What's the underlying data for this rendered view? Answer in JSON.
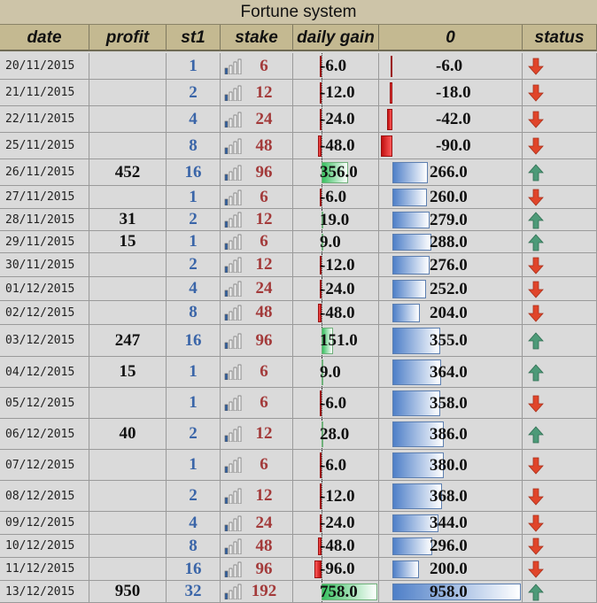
{
  "title": "Fortune system",
  "headers": [
    "date",
    "profit",
    "st1",
    "stake",
    "daily gain",
    "0",
    "status"
  ],
  "colors": {
    "up": "#4d9a78",
    "down": "#e0452a"
  },
  "rows": [
    {
      "date": "20/11/2015",
      "profit": "",
      "st1": "1",
      "stake": "6",
      "gain": "-6.0",
      "cum": "-6.0",
      "status": "down-arrow-icon"
    },
    {
      "date": "21/11/2015",
      "profit": "",
      "st1": "2",
      "stake": "12",
      "gain": "-12.0",
      "cum": "-18.0",
      "status": "down-arrow-icon"
    },
    {
      "date": "22/11/2015",
      "profit": "",
      "st1": "4",
      "stake": "24",
      "gain": "-24.0",
      "cum": "-42.0",
      "status": "down-arrow-icon"
    },
    {
      "date": "25/11/2015",
      "profit": "",
      "st1": "8",
      "stake": "48",
      "gain": "-48.0",
      "cum": "-90.0",
      "status": "down-arrow-icon"
    },
    {
      "date": "26/11/2015",
      "profit": "452",
      "st1": "16",
      "stake": "96",
      "gain": "356.0",
      "cum": "266.0",
      "status": "up-arrow-icon"
    },
    {
      "date": "27/11/2015",
      "profit": "",
      "st1": "1",
      "stake": "6",
      "gain": "-6.0",
      "cum": "260.0",
      "status": "down-arrow-icon"
    },
    {
      "date": "28/11/2015",
      "profit": "31",
      "st1": "2",
      "stake": "12",
      "gain": "19.0",
      "cum": "279.0",
      "status": "up-arrow-icon"
    },
    {
      "date": "29/11/2015",
      "profit": "15",
      "st1": "1",
      "stake": "6",
      "gain": "9.0",
      "cum": "288.0",
      "status": "up-arrow-icon"
    },
    {
      "date": "30/11/2015",
      "profit": "",
      "st1": "2",
      "stake": "12",
      "gain": "-12.0",
      "cum": "276.0",
      "status": "down-arrow-icon"
    },
    {
      "date": "01/12/2015",
      "profit": "",
      "st1": "4",
      "stake": "24",
      "gain": "-24.0",
      "cum": "252.0",
      "status": "down-arrow-icon"
    },
    {
      "date": "02/12/2015",
      "profit": "",
      "st1": "8",
      "stake": "48",
      "gain": "-48.0",
      "cum": "204.0",
      "status": "down-arrow-icon"
    },
    {
      "date": "03/12/2015",
      "profit": "247",
      "st1": "16",
      "stake": "96",
      "gain": "151.0",
      "cum": "355.0",
      "status": "up-arrow-icon"
    },
    {
      "date": "04/12/2015",
      "profit": "15",
      "st1": "1",
      "stake": "6",
      "gain": "9.0",
      "cum": "364.0",
      "status": "up-arrow-icon"
    },
    {
      "date": "05/12/2015",
      "profit": "",
      "st1": "1",
      "stake": "6",
      "gain": "-6.0",
      "cum": "358.0",
      "status": "down-arrow-icon"
    },
    {
      "date": "06/12/2015",
      "profit": "40",
      "st1": "2",
      "stake": "12",
      "gain": "28.0",
      "cum": "386.0",
      "status": "up-arrow-icon"
    },
    {
      "date": "07/12/2015",
      "profit": "",
      "st1": "1",
      "stake": "6",
      "gain": "-6.0",
      "cum": "380.0",
      "status": "down-arrow-icon"
    },
    {
      "date": "08/12/2015",
      "profit": "",
      "st1": "2",
      "stake": "12",
      "gain": "-12.0",
      "cum": "368.0",
      "status": "down-arrow-icon"
    },
    {
      "date": "09/12/2015",
      "profit": "",
      "st1": "4",
      "stake": "24",
      "gain": "-24.0",
      "cum": "344.0",
      "status": "down-arrow-icon"
    },
    {
      "date": "10/12/2015",
      "profit": "",
      "st1": "8",
      "stake": "48",
      "gain": "-48.0",
      "cum": "296.0",
      "status": "down-arrow-icon"
    },
    {
      "date": "11/12/2015",
      "profit": "",
      "st1": "16",
      "stake": "96",
      "gain": "-96.0",
      "cum": "200.0",
      "status": "down-arrow-icon"
    },
    {
      "date": "13/12/2015",
      "profit": "950",
      "st1": "32",
      "stake": "192",
      "gain": "758.0",
      "cum": "958.0",
      "status": "up-arrow-icon"
    }
  ]
}
